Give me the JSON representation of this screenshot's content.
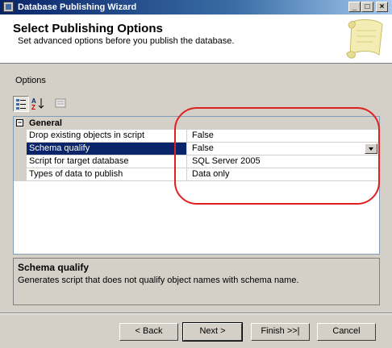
{
  "window": {
    "title": "Database Publishing Wizard",
    "controls": [
      "_",
      "□",
      "×"
    ]
  },
  "header": {
    "title": "Select Publishing Options",
    "subtitle": "Set advanced options before you publish the database."
  },
  "options_label": "Options",
  "toolbar": {
    "icons": [
      "categorized-icon",
      "alphabetical-icon",
      "property-pages-icon"
    ]
  },
  "property_grid": {
    "category": {
      "label": "General",
      "expander": "⊟"
    },
    "rows": [
      {
        "name": "Drop existing objects in script",
        "value": "False"
      },
      {
        "name": "Schema qualify",
        "value": "False",
        "selected": true
      },
      {
        "name": "Script for target database",
        "value": "SQL Server 2005"
      },
      {
        "name": "Types of data to publish",
        "value": "Data only"
      }
    ]
  },
  "description": {
    "title": "Schema qualify",
    "text": "Generates script that does not qualify object names with schema name."
  },
  "buttons": {
    "back": "< Back",
    "next": "Next >",
    "finish": "Finish >>|",
    "cancel": "Cancel"
  },
  "colors": {
    "titlebar": "#0a246a",
    "selection": "#0a246a",
    "annotation": "#e02020",
    "dialog": "#d4d0c8"
  }
}
